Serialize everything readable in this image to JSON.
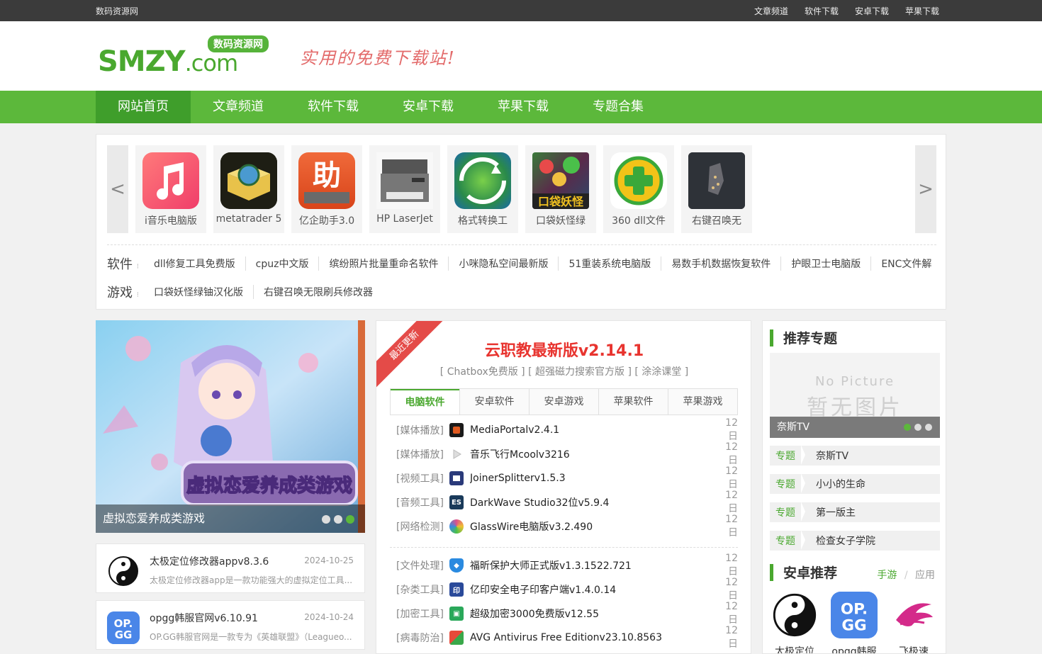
{
  "topbar": {
    "site_name": "数码资源网",
    "links": [
      "文章频道",
      "软件下载",
      "安卓下载",
      "苹果下载"
    ]
  },
  "header": {
    "logo_badge": "数码资源网",
    "logo_word": "SMZY",
    "logo_suffix": ".com",
    "slogan": "实用的免费下载站!"
  },
  "nav": {
    "items": [
      "网站首页",
      "文章频道",
      "软件下载",
      "安卓下载",
      "苹果下载",
      "专题合集"
    ]
  },
  "carousel": {
    "prev": "<",
    "next": ">",
    "tiles": [
      {
        "name": "i音乐电脑版",
        "icon": "music-note-icon",
        "color": "#f55a6a"
      },
      {
        "name": "metatrader 5",
        "icon": "book-globe-icon",
        "color": "#d8b43a"
      },
      {
        "name": "亿企助手3.0",
        "icon": "assistant-icon",
        "color": "#e85a2a"
      },
      {
        "name": "HP LaserJet",
        "icon": "printer-icon",
        "color": "#7a7a7a"
      },
      {
        "name": "格式转换工",
        "icon": "convert-icon",
        "color": "#3aa84a"
      },
      {
        "name": "口袋妖怪绿",
        "icon": "game-art-icon",
        "color": "#2d5a2a"
      },
      {
        "name": "360 dll文件",
        "icon": "plus-shield-icon",
        "color": "#f2c318"
      },
      {
        "name": "右键召唤无",
        "icon": "game-map-icon",
        "color": "#3a3a3a"
      }
    ]
  },
  "quicklinks": {
    "software_label": "软件",
    "software": [
      "dll修复工具免费版",
      "cpuz中文版",
      "缤纷照片批量重命名软件",
      "小咪隐私空间最新版",
      "51重装系统电脑版",
      "易数手机数据恢复软件",
      "护眼卫士电脑版",
      "ENC文件解"
    ],
    "games_label": "游戏",
    "games": [
      "口袋妖怪绿铀汉化版",
      "右键召唤无限刷兵修改器"
    ]
  },
  "slideshow": {
    "caption": "虚拟恋爱养成类游戏",
    "banner_text": "虚拟恋爱养成类游戏"
  },
  "cards": [
    {
      "title": "太极定位修改器appv8.3.6",
      "date": "2024-10-25",
      "summary": "太极定位修改器app是一款功能强大的虚拟定位工具...",
      "icon": "taiji-icon"
    },
    {
      "title": "opgg韩服官网v6.10.91",
      "date": "2024-10-24",
      "summary": "OP.GG韩服官网是一款专为《英雄联盟》（Leagueo...",
      "icon": "opgg-icon"
    }
  ],
  "center": {
    "ribbon": "最近更新",
    "headline": "云职教最新版v2.14.1",
    "sub_links": "[  Chatbox免费版  ] [  超强磁力搜索官方版  ] [  涂涂课堂  ]",
    "tabs": [
      "电脑软件",
      "安卓软件",
      "安卓游戏",
      "苹果软件",
      "苹果游戏"
    ],
    "list_a": [
      {
        "cat": "[媒体播放]",
        "name": "MediaPortalv2.4.1",
        "date": "12日",
        "color": "#e05a20"
      },
      {
        "cat": "[媒体播放]",
        "name": "音乐飞行Mcoolv3216",
        "date": "12日",
        "color": "#cfcfcf"
      },
      {
        "cat": "[视频工具]",
        "name": "JoinerSplitterv1.5.3",
        "date": "12日",
        "color": "#2a3a7a"
      },
      {
        "cat": "[音频工具]",
        "name": "DarkWave Studio32位v5.9.4",
        "date": "12日",
        "color": "#1a3a5a"
      },
      {
        "cat": "[网络检测]",
        "name": "GlassWire电脑版v3.2.490",
        "date": "12日",
        "color": "#e0508a"
      }
    ],
    "list_b": [
      {
        "cat": "[文件处理]",
        "name": "福昕保护大师正式版v1.3.1522.721",
        "date": "12日",
        "color": "#2a8ae0"
      },
      {
        "cat": "[杂类工具]",
        "name": "亿印安全电子印客户端v1.4.0.14",
        "date": "12日",
        "color": "#2a4a9a"
      },
      {
        "cat": "[加密工具]",
        "name": "超级加密3000免费版v12.55",
        "date": "12日",
        "color": "#2aa85a"
      },
      {
        "cat": "[病毒防治]",
        "name": "AVG Antivirus Free Editionv23.10.8563",
        "date": "12日",
        "color": "#e8a020"
      }
    ]
  },
  "right": {
    "title1": "推荐专题",
    "nopic_en": "No Picture",
    "nopic_cn": "暂无图片",
    "nopic_caption": "奈斯TV",
    "topics": [
      {
        "tag": "专题",
        "name": "奈斯TV"
      },
      {
        "tag": "专题",
        "name": "小小的生命"
      },
      {
        "tag": "专题",
        "name": "第一版主"
      },
      {
        "tag": "专题",
        "name": "检查女子学院"
      }
    ],
    "title2": "安卓推荐",
    "tab_games": "手游",
    "tab_divider": "/",
    "tab_apps": "应用",
    "apps": [
      {
        "name": "太极定位",
        "icon": "taiji-icon"
      },
      {
        "name": "opgg韩服",
        "icon": "opgg-icon"
      },
      {
        "name": "飞极速",
        "icon": "feijisu-icon"
      }
    ]
  }
}
